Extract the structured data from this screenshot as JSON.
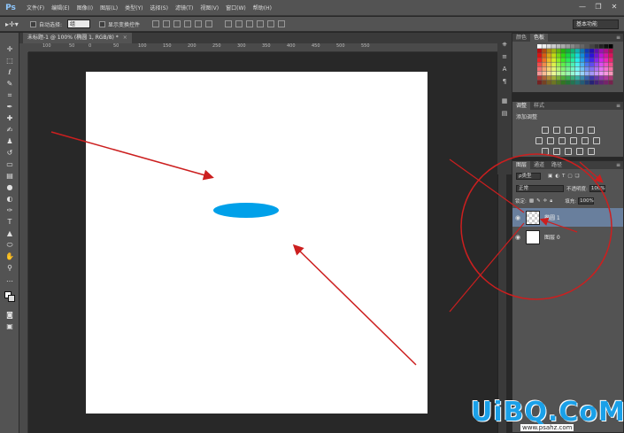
{
  "app": {
    "logo": "Ps",
    "workspace": "基本功能"
  },
  "menu": [
    "文件(F)",
    "编辑(E)",
    "图像(I)",
    "图层(L)",
    "类型(Y)",
    "选择(S)",
    "滤镜(T)",
    "视图(V)",
    "窗口(W)",
    "帮助(H)"
  ],
  "window_controls": [
    "—",
    "❐",
    "✕"
  ],
  "options": {
    "auto_select_label": "自动选择:",
    "auto_select_value": "组",
    "transform_label": "显示变换控件"
  },
  "document": {
    "tab_title": "未标题-1 @ 100% (椭圆 1, RGB/8) *",
    "close": "×"
  },
  "ruler_top_labels": [
    "100",
    "50",
    "0",
    "50",
    "100",
    "150",
    "200",
    "250",
    "300",
    "350",
    "400",
    "450",
    "500",
    "550"
  ],
  "panels": {
    "swatches": {
      "tabs": [
        "颜色",
        "色板"
      ]
    },
    "adjustments": {
      "tabs": [
        "调整",
        "样式"
      ],
      "title": "添加调整"
    },
    "layers": {
      "tabs": [
        "图层",
        "通道",
        "路径"
      ],
      "filter": "ρ类型",
      "blend_mode": "正常",
      "opacity_label": "不透明度:",
      "opacity_value": "100%",
      "lock_label": "锁定:",
      "fill_label": "填充:",
      "fill_value": "100%",
      "items": [
        {
          "name": "椭圆 1",
          "selected": true
        },
        {
          "name": "图层 0",
          "selected": false
        }
      ]
    }
  },
  "watermark": {
    "logo": "UiBQ.CoM",
    "url": "www.psahz.com"
  },
  "colors": {
    "ellipse": "#00a0e9",
    "arrow": "#cc1f1f",
    "selection": "#697f9d"
  }
}
